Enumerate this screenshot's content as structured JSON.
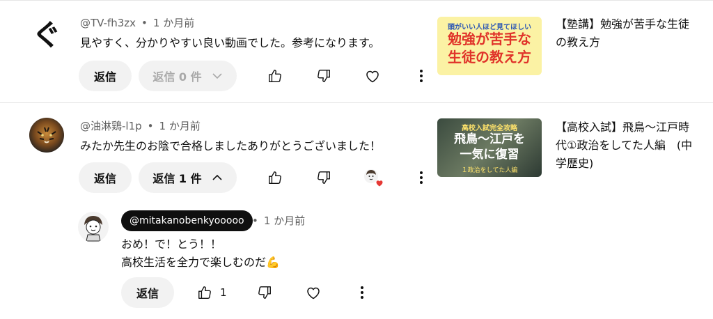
{
  "comments": [
    {
      "avatar_glyph": "ぐ",
      "username": "@TV-fh3zx",
      "time": "1 か月前",
      "text": "見やすく、分かりやすい良い動画でした。参考になります。",
      "reply_label": "返信",
      "replies_toggle": "返信 0 件",
      "video": {
        "thumb_top": "頭がいい人ほど見てほしい",
        "thumb_main_1": "勉強が苦手な",
        "thumb_main_2": "生徒の教え方",
        "title_line1": "【塾講】勉強が苦手な生徒",
        "title_line2": "の教え方"
      }
    },
    {
      "username": "@油淋鶏-l1p",
      "time": "1 か月前",
      "text": "みたか先生のお陰で合格しましたありがとうございました！",
      "reply_label": "返信",
      "replies_toggle": "返信 1 件",
      "video": {
        "thumb_top": "高校入試完全攻略",
        "thumb_main_1": "飛鳥〜江戸を",
        "thumb_main_2": "一気に復習",
        "thumb_sub": "１政治をしてた人編",
        "title_line1": "【高校入試】飛鳥〜江戸時",
        "title_line2": "代①政治をしてた人編　(中",
        "title_line3": "学歴史)"
      }
    }
  ],
  "reply": {
    "username": "@mitakanobenkyooooo",
    "time": "1 か月前",
    "line1": "おめ！で！とう！！",
    "line2": "高校生活を全力で楽しむのだ💪",
    "reply_label": "返信",
    "like_count": "1"
  },
  "colors": {
    "heart_red": "#e53935",
    "pill_bg": "#f2f2f2"
  }
}
